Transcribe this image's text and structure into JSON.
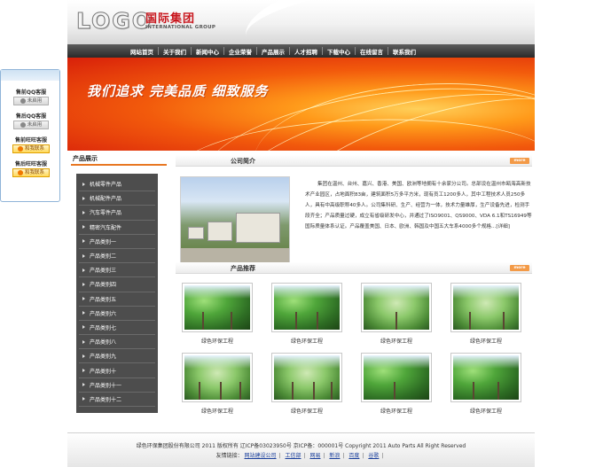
{
  "qq_panel": {
    "groups": [
      {
        "title": "售前QQ客服",
        "badge": "未启用",
        "kind": "qq"
      },
      {
        "title": "售后QQ客服",
        "badge": "未启用",
        "kind": "qq"
      },
      {
        "title": "售前旺旺客服",
        "badge": "和我联系",
        "kind": "ww"
      },
      {
        "title": "售后旺旺客服",
        "badge": "和我联系",
        "kind": "ww"
      }
    ]
  },
  "header": {
    "logo_text": "LOGO",
    "company_cn": "国际集团",
    "company_en": "INTERNATIONAL GROUP"
  },
  "nav": {
    "items": [
      "网站首页",
      "关于我们",
      "新闻中心",
      "企业荣誉",
      "产品展示",
      "人才招聘",
      "下载中心",
      "在线留言",
      "联系我们"
    ]
  },
  "banner": {
    "slogan": "我们追求  完美品质  细致服务"
  },
  "sidebar": {
    "title": "产品展示",
    "items": [
      "机械零件产品",
      "机械配件产品",
      "汽车零件产品",
      "精密汽车配件",
      "产品类别一",
      "产品类别二",
      "产品类别三",
      "产品类别四",
      "产品类别五",
      "产品类别六",
      "产品类别七",
      "产品类别八",
      "产品类别九",
      "产品类别十",
      "产品类别十一",
      "产品类别十二"
    ]
  },
  "intro": {
    "title": "公司简介",
    "more": "more",
    "text": "集团在温州、台州、嘉兴、香港、美国、欧洲等地拥有十余家分公司。总部设在温州市瓯海高新技术产业园区，占地面积83亩，建筑面积5万多平方米，现有员工1200多人，其中工程技术人员250多人，具有中高级职称40多人。公司集科研、生产、经营为一体，技术力量雄厚，生产设备先进，检测手段齐全；产品质量过硬，成立有省级研发中心，并通过了ISO9001、QS9000、VDA 6.1和TS16949等国际质量体系认证。产品覆盖美国、日本、欧洲、韩国及中国五大车系4000多个规格...[详细]"
  },
  "products": {
    "title": "产品推荐",
    "more": "more",
    "items": [
      {
        "caption": "绿色环保工程"
      },
      {
        "caption": "绿色环保工程"
      },
      {
        "caption": "绿色环保工程"
      },
      {
        "caption": "绿色环保工程"
      },
      {
        "caption": "绿色环保工程"
      },
      {
        "caption": "绿色环保工程"
      },
      {
        "caption": "绿色环保工程"
      },
      {
        "caption": "绿色环保工程"
      }
    ]
  },
  "footer": {
    "copyright": "绿色环保集团股份有限公司 2011 版权所有 辽ICP备03023950号 京ICP备：000001号 Copyright 2011 Auto Parts All Right Reserved",
    "links_label": "友情链接：",
    "links": [
      "网站建设公司",
      "工信部",
      "网易",
      "新浪",
      "百度",
      "谷歌"
    ]
  }
}
